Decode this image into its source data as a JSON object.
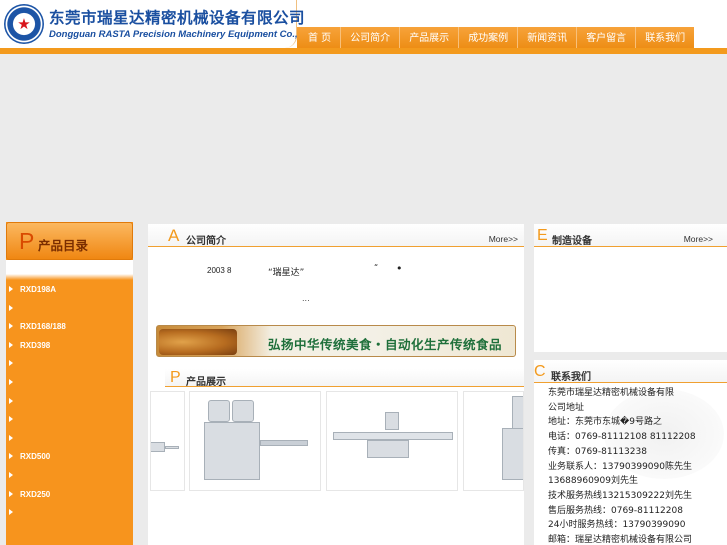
{
  "header": {
    "logo_icon": "red-star-emblem",
    "company_cn": "东莞市瑞星达精密机械设备有限公司",
    "company_en": "Dongguan RASTA Precision Machinery Equipment Co., Ltd.",
    "nav": [
      "首 页",
      "公司简介",
      "产品展示",
      "成功案例",
      "新闻资讯",
      "客户留言",
      "联系我们"
    ]
  },
  "left": {
    "title_initial": "P",
    "title": "产品目录",
    "items": [
      "RXD198A",
      "",
      "RXD168/188",
      "RXD398",
      "",
      "",
      "",
      "",
      "",
      "RXD500",
      "",
      "RXD250",
      ""
    ]
  },
  "about": {
    "title_initial": "A",
    "title": "公司简介",
    "more": "More>>",
    "year_text": "2003 8",
    "quote1": "“瑞星达”",
    "quote2": "“",
    "dot": "•",
    "ellipsis": "..."
  },
  "banner": {
    "text": "弘扬中华传统美食・自动化生产传统食品"
  },
  "products": {
    "title_initial": "P",
    "title": "产品展示"
  },
  "equipment": {
    "title_initial": "E",
    "title": "制造设备",
    "more": "More>>"
  },
  "contact": {
    "title_initial": "C",
    "title": "联系我们",
    "lines": [
      "东莞市瑞星达精密机械设备有限",
      "公司地址",
      "地址：东莞市东城�9号路之",
      "电话：0769-81112108 81112208",
      "传真：0769-81113238",
      "业务联系人：13790399090陈先生",
      "13688960909刘先生",
      "技术服务热线13215309222刘先生",
      "售后服务热线：0769-81112208",
      "24小时服务热线：13790399090",
      "邮箱：瑞星达精密机械设备有限公司"
    ]
  },
  "colors": {
    "brand_orange": "#f39a1d",
    "brand_blue": "#1a4fa0",
    "banner_green": "#1e6f3a"
  }
}
